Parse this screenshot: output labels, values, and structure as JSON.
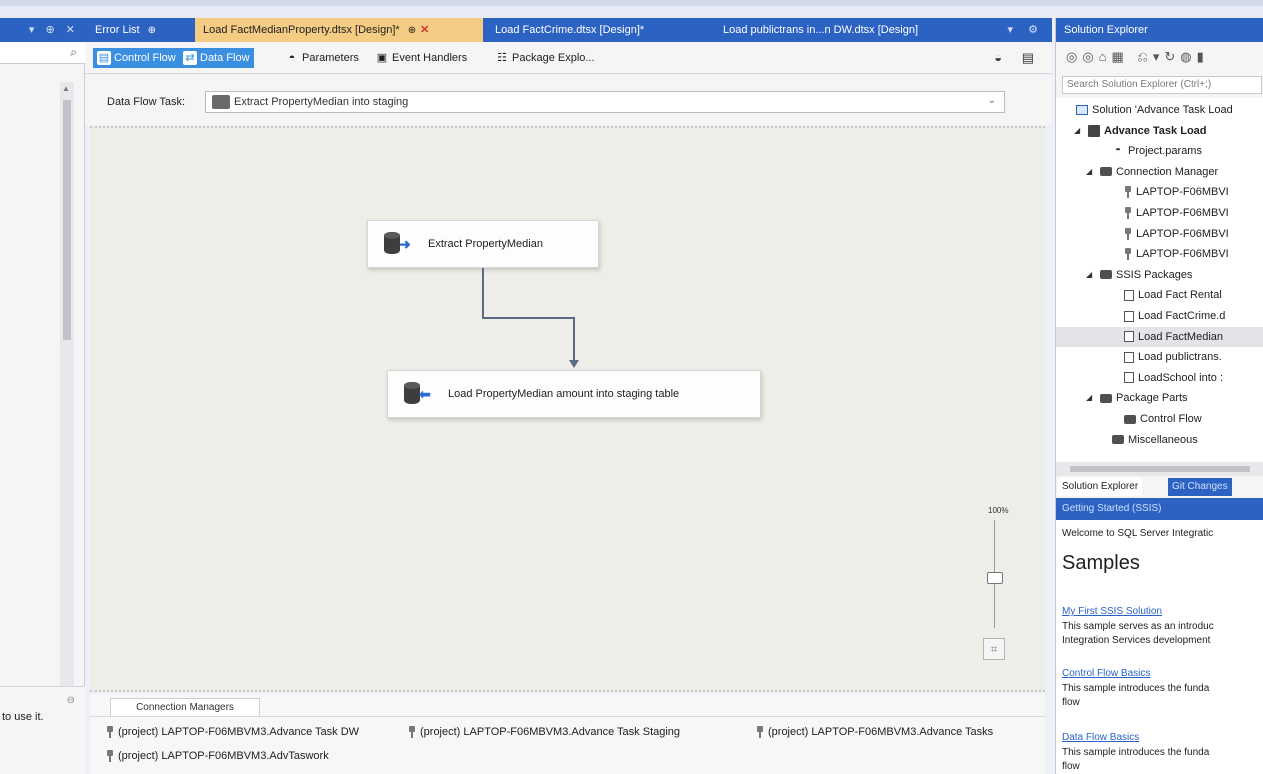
{
  "left_panel": {
    "bottom_text": "to use it."
  },
  "doc_tabs": [
    {
      "label": "Error List",
      "pin": "⊕",
      "active": false
    },
    {
      "label": "Load FactMedianProperty.dtsx [Design]*",
      "pin": "⊕",
      "close": "✕",
      "active": true
    },
    {
      "label": "Load FactCrime.dtsx [Design]*",
      "active": false
    },
    {
      "label": "Load publictrans in...n DW.dtsx [Design]",
      "active": false
    }
  ],
  "designer_tabs": [
    {
      "label": "Control Flow",
      "selected": true
    },
    {
      "label": "Data Flow",
      "selected": true
    },
    {
      "label": "Parameters",
      "selected": false
    },
    {
      "label": "Event Handlers",
      "selected": false
    },
    {
      "label": "Package Explo...",
      "selected": false
    }
  ],
  "data_flow_task": {
    "label": "Data Flow Task:",
    "value": "Extract PropertyMedian into staging"
  },
  "canvas": {
    "source_node": "Extract PropertyMedian",
    "dest_node": "Load PropertyMedian amount into staging table",
    "zoom": "100%"
  },
  "connection_managers": {
    "tab_label": "Connection Managers",
    "items": [
      "(project) LAPTOP-F06MBVM3.Advance Task DW",
      "(project) LAPTOP-F06MBVM3.Advance Task Staging",
      "(project) LAPTOP-F06MBVM3.Advance Tasks",
      "(project) LAPTOP-F06MBVM3.AdvTaswork"
    ]
  },
  "solution_explorer": {
    "title": "Solution Explorer",
    "search_placeholder": "Search Solution Explorer (Ctrl+;)",
    "tree": [
      {
        "label": "Solution 'Advance Task Load",
        "indent": 0,
        "icon": "solution-icon"
      },
      {
        "label": "Advance Task Load",
        "indent": 1,
        "icon": "project-icon",
        "bold": true,
        "expander": "◢"
      },
      {
        "label": "Project.params",
        "indent": 3,
        "icon": "params-icon"
      },
      {
        "label": "Connection Manager",
        "indent": 2,
        "icon": "folder-icon",
        "expander": "◢"
      },
      {
        "label": "LAPTOP-F06MBVI",
        "indent": 4,
        "icon": "connection-icon"
      },
      {
        "label": "LAPTOP-F06MBVI",
        "indent": 4,
        "icon": "connection-icon"
      },
      {
        "label": "LAPTOP-F06MBVI",
        "indent": 4,
        "icon": "connection-icon"
      },
      {
        "label": "LAPTOP-F06MBVI",
        "indent": 4,
        "icon": "connection-icon"
      },
      {
        "label": "SSIS Packages",
        "indent": 2,
        "icon": "folder-icon",
        "expander": "◢"
      },
      {
        "label": "Load Fact Rental",
        "indent": 4,
        "icon": "package-icon"
      },
      {
        "label": "Load FactCrime.d",
        "indent": 4,
        "icon": "package-icon"
      },
      {
        "label": "Load FactMedian",
        "indent": 4,
        "icon": "package-icon",
        "selected": true
      },
      {
        "label": "Load publictrans.",
        "indent": 4,
        "icon": "package-icon"
      },
      {
        "label": "LoadSchool into :",
        "indent": 4,
        "icon": "package-icon"
      },
      {
        "label": "Package Parts",
        "indent": 2,
        "icon": "folder-icon",
        "expander": "◢"
      },
      {
        "label": "Control Flow",
        "indent": 4,
        "icon": "folder-icon"
      },
      {
        "label": "Miscellaneous",
        "indent": 3,
        "icon": "folder-icon"
      }
    ],
    "bottom_tabs": [
      "Solution Explorer",
      "Git Changes"
    ]
  },
  "getting_started": {
    "title": "Getting Started (SSIS)",
    "welcome": "Welcome to SQL Server Integratic",
    "samples_heading": "Samples",
    "samples": [
      {
        "link": "My First SSIS Solution",
        "desc1": "This sample serves as an introduc",
        "desc2": "Integration Services development"
      },
      {
        "link": "Control Flow Basics",
        "desc1": "This sample introduces the funda",
        "desc2": "flow"
      },
      {
        "link": "Data Flow Basics",
        "desc1": "This sample introduces the funda",
        "desc2": "flow"
      }
    ]
  },
  "colors": {
    "accent": "#2c62c2",
    "active_tab": "#f5cc84",
    "canvas": "#efede8",
    "selected_tab": "#3b8fe0"
  }
}
